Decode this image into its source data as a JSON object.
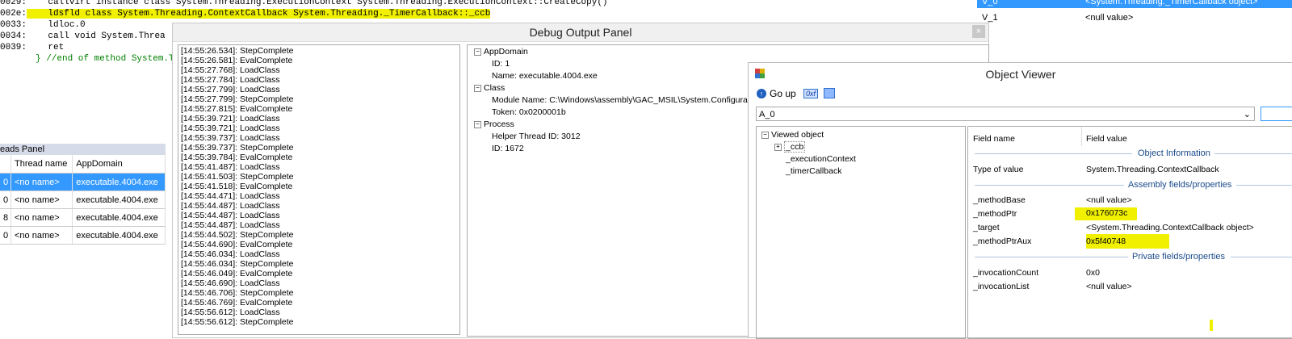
{
  "code": {
    "lines": [
      {
        "addr": "0029:",
        "text": "    callvirt instance class System.Threading.ExecutionContext System.Threading.ExecutionContext::CreateCopy()"
      },
      {
        "addr": "002e:",
        "text": "    ldsfld class System.Threading.ContextCallback System.Threading._TimerCallback::_ccb"
      },
      {
        "addr": "0033:",
        "text": "    ldloc.0"
      },
      {
        "addr": "0034:",
        "text": "    call void System.Threa"
      },
      {
        "addr": "0039:",
        "text": "    ret"
      }
    ],
    "end_comment": "} //end of method System.T"
  },
  "threads_panel": {
    "title": "eads Panel",
    "columns": [
      "Thread name",
      "AppDomain"
    ],
    "rows": [
      {
        "id": "0",
        "name": "<no name>",
        "domain": "executable.4004.exe"
      },
      {
        "id": "0",
        "name": "<no name>",
        "domain": "executable.4004.exe"
      },
      {
        "id": "8",
        "name": "<no name>",
        "domain": "executable.4004.exe"
      },
      {
        "id": "0",
        "name": "<no name>",
        "domain": "executable.4004.exe"
      }
    ]
  },
  "debug_panel": {
    "title": "Debug Output Panel",
    "close": "×",
    "log": [
      "[14:55:26.534]: StepComplete",
      "[14:55:26.581]: EvalComplete",
      "[14:55:27.768]: LoadClass",
      "[14:55:27.784]: LoadClass",
      "[14:55:27.799]: LoadClass",
      "[14:55:27.799]: StepComplete",
      "[14:55:27.815]: EvalComplete",
      "[14:55:39.721]: LoadClass",
      "[14:55:39.721]: LoadClass",
      "[14:55:39.737]: LoadClass",
      "[14:55:39.737]: StepComplete",
      "[14:55:39.784]: EvalComplete",
      "[14:55:41.487]: LoadClass",
      "[14:55:41.503]: StepComplete",
      "[14:55:41.518]: EvalComplete",
      "[14:55:44.471]: LoadClass",
      "[14:55:44.487]: LoadClass",
      "[14:55:44.487]: LoadClass",
      "[14:55:44.487]: LoadClass",
      "[14:55:44.502]: StepComplete",
      "[14:55:44.690]: EvalComplete",
      "[14:55:46.034]: LoadClass",
      "[14:55:46.034]: StepComplete",
      "[14:55:46.049]: EvalComplete",
      "[14:55:46.690]: LoadClass",
      "[14:55:46.706]: StepComplete",
      "[14:55:46.769]: EvalComplete",
      "[14:55:56.612]: LoadClass",
      "[14:55:56.612]: StepComplete"
    ],
    "tree": {
      "appdomain": "AppDomain",
      "appdomain_id": "ID: 1",
      "appdomain_name": "Name: executable.4004.exe",
      "class": "Class",
      "module": "Module Name: C:\\Windows\\assembly\\GAC_MSIL\\System.Configurati",
      "token": "Token: 0x0200001b",
      "process": "Process",
      "helper": "Helper Thread ID: 3012",
      "pid": "ID: 1672"
    }
  },
  "top_right": {
    "row1_name": "V_0",
    "row1_value": "<System.Threading._TimerCallback object>",
    "row2_name": "V_1",
    "row2_value": "<null value>"
  },
  "object_viewer": {
    "title": "Object Viewer",
    "go_up": "Go up",
    "hex_label": "0xf",
    "combo_value": "A_0",
    "tree": {
      "root": "Viewed object",
      "ccb": "_ccb",
      "exec": "_executionContext",
      "timer": "_timerCallback"
    },
    "grid": {
      "col_name": "Field name",
      "col_value": "Field value",
      "sec_info": "Object Information",
      "type_name": "Type of value",
      "type_value": "System.Threading.ContextCallback",
      "sec_assembly": "Assembly fields/properties",
      "f1_name": "_methodBase",
      "f1_value": "<null value>",
      "f2_name": "_methodPtr",
      "f2_value": "0x176073c",
      "f3_name": "_target",
      "f3_value": "<System.Threading.ContextCallback object>",
      "f4_name": "_methodPtrAux",
      "f4_value": "0x5f40748",
      "sec_private": "Private fields/properties",
      "f5_name": "_invocationCount",
      "f5_value": "0x0",
      "f6_name": "_invocationList",
      "f6_value": "<null value>"
    }
  },
  "colors": {
    "highlight": "#f0f000",
    "selection": "#3399ff",
    "section_text": "#1a4a8a"
  }
}
